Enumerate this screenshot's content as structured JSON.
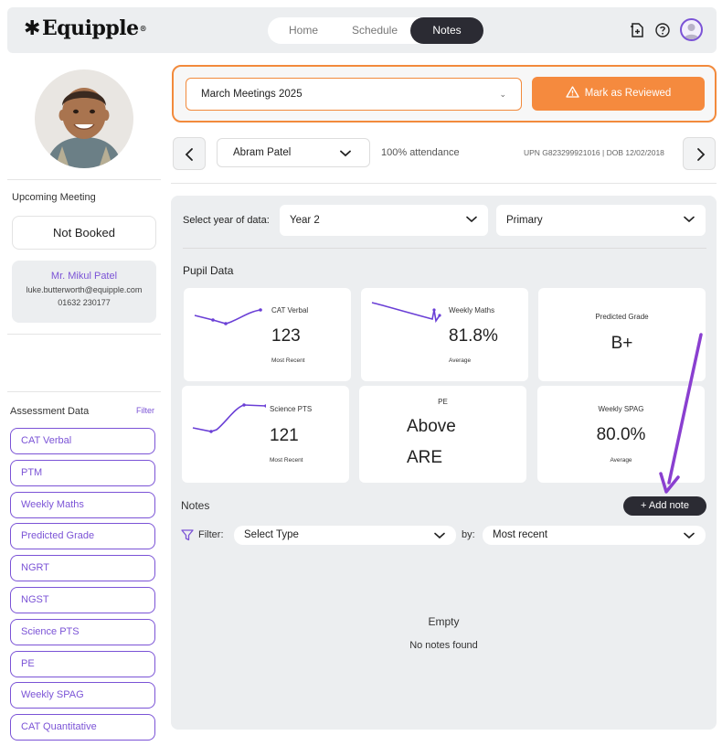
{
  "app": {
    "logo_text": "Equipple",
    "logo_mark": "®"
  },
  "nav": {
    "tabs": [
      "Home",
      "Schedule",
      "Notes"
    ],
    "active": "Notes"
  },
  "header_icons": [
    "add-document-icon",
    "help-icon",
    "user-avatar-icon"
  ],
  "sidebar": {
    "upcoming_title": "Upcoming Meeting",
    "booking_status": "Not Booked",
    "contact": {
      "name": "Mr. Mikul Patel",
      "email": "luke.butterworth@equipple.com",
      "phone": "01632 230177"
    },
    "assessment_title": "Assessment Data",
    "filter_label": "Filter",
    "assessments": [
      "CAT Verbal",
      "PTM",
      "Weekly Maths",
      "Predicted Grade",
      "NGRT",
      "NGST",
      "Science PTS",
      "PE",
      "Weekly SPAG",
      "CAT Quantitative"
    ]
  },
  "meeting": {
    "selected": "March Meetings 2025",
    "review_button": "Mark as Reviewed"
  },
  "pupil": {
    "name": "Abram Patel",
    "attendance": "100% attendance",
    "ids": "UPN G823299921016 | DOB 12/02/2018"
  },
  "filters": {
    "year_label": "Select year of data:",
    "year_value": "Year 2",
    "phase_value": "Primary"
  },
  "pupil_data": {
    "title": "Pupil Data",
    "cards": [
      {
        "label": "CAT Verbal",
        "value": "123",
        "sub": "Most Recent"
      },
      {
        "label": "Weekly Maths",
        "value": "81.8%",
        "sub": "Average"
      },
      {
        "label": "Predicted Grade",
        "value": "B+",
        "sub": ""
      },
      {
        "label": "Science PTS",
        "value": "121",
        "sub": "Most Recent"
      },
      {
        "label": "PE",
        "value": "Above",
        "value2": "ARE",
        "sub": ""
      },
      {
        "label": "Weekly SPAG",
        "value": "80.0%",
        "sub": "Average"
      }
    ]
  },
  "notes": {
    "title": "Notes",
    "add_button": "+ Add note",
    "filter_label": "Filter:",
    "type_placeholder": "Select Type",
    "by_label": "by:",
    "sort_value": "Most recent",
    "empty_title": "Empty",
    "empty_message": "No notes found"
  },
  "colors": {
    "accent": "#7b53d6",
    "orange": "#f58a3e",
    "dark": "#2b2b33",
    "panel": "#eceef0"
  }
}
